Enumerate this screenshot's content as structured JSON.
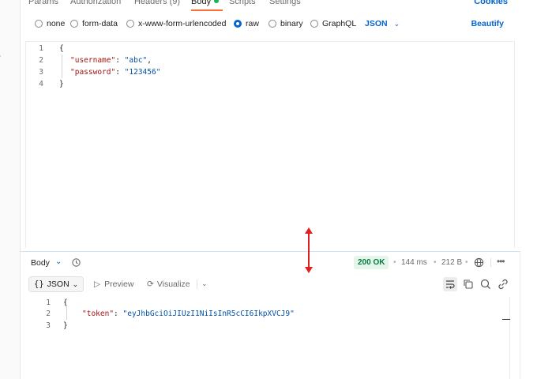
{
  "sidebar": {
    "clip1": "s",
    "clip2": "ry"
  },
  "request_tabs": [
    {
      "label": "Params"
    },
    {
      "label": "Authorization"
    },
    {
      "label": "Headers (9)"
    },
    {
      "label": "Body"
    },
    {
      "label": "Scripts"
    },
    {
      "label": "Settings"
    }
  ],
  "cookies_label": "Cookies",
  "body_types": [
    "none",
    "form-data",
    "x-www-form-urlencoded",
    "raw",
    "binary",
    "GraphQL"
  ],
  "selected_body_type": "raw",
  "language_select": "JSON",
  "beautify_label": "Beautify",
  "request_code": {
    "line_numbers": [
      "1",
      "2",
      "3",
      "4"
    ],
    "open": "{",
    "username_key": "\"username\"",
    "username_val": "\"abc\"",
    "password_key": "\"password\"",
    "password_val": "\"123456\"",
    "close": "}"
  },
  "response": {
    "tab_label": "Body",
    "status": "200 OK",
    "time": "144 ms",
    "size": "212 B",
    "format": "JSON",
    "format_braces": "{}",
    "preview_label": "Preview",
    "visualize_label": "Visualize",
    "code": {
      "line_numbers": [
        "1",
        "2",
        "3"
      ],
      "open": "{",
      "token_key": "\"token\"",
      "token_val": "\"eyJhbGciOiJIUzI1NiIsInR5cCI6IkpXVCJ9\"",
      "close": "}"
    }
  },
  "colors": {
    "accent_blue": "#0265d2",
    "active_tab_underline": "#ff6c37",
    "status_green": "#067a3f",
    "resize_arrow_red": "#e02020"
  },
  "icons": [
    "history-icon",
    "globe-icon",
    "more-icon",
    "wrap-lines-icon",
    "copy-icon",
    "search-icon",
    "link-icon",
    "preview-play-icon",
    "visualize-icon"
  ]
}
